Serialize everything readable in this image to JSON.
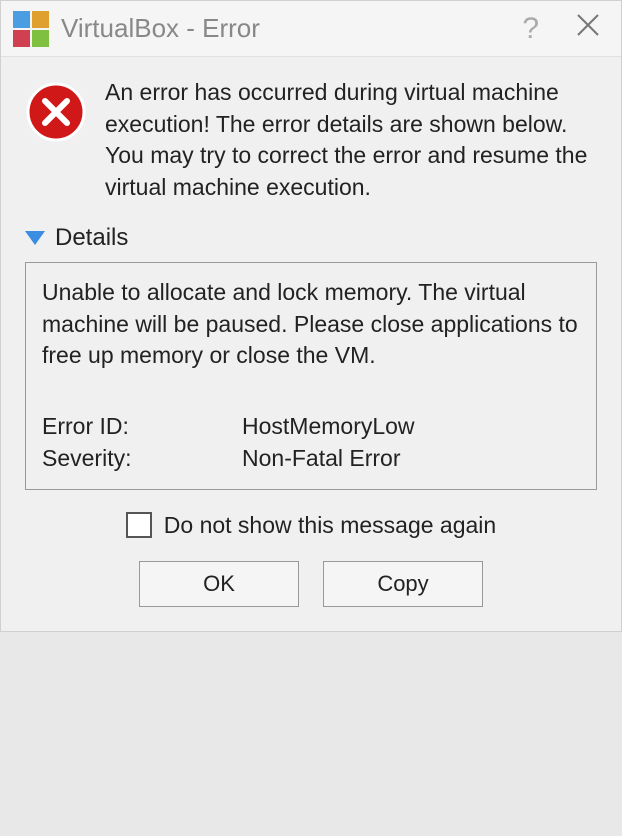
{
  "title": "VirtualBox - Error",
  "message": "An error has occurred during virtual machine execution! The error details are shown below. You may try to correct the error and resume the virtual machine execution.",
  "details": {
    "header": "Details",
    "text": "Unable to allocate and lock memory. The virtual machine will be paused. Please close applications to free up memory or close the VM.",
    "error_id_label": "Error ID:",
    "error_id_value": "HostMemoryLow",
    "severity_label": "Severity:",
    "severity_value": "Non-Fatal Error"
  },
  "checkbox_label": "Do not show this message again",
  "buttons": {
    "ok": "OK",
    "copy": "Copy"
  }
}
